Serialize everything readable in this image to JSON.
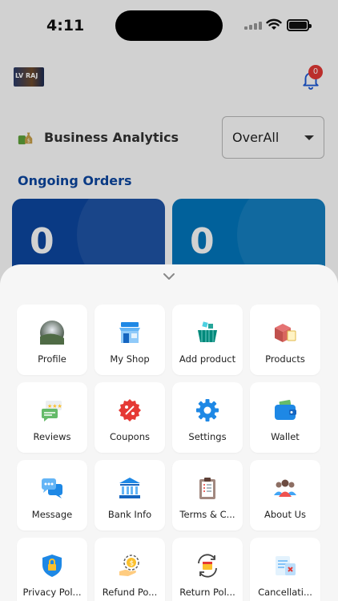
{
  "status_bar": {
    "time": "4:11"
  },
  "header": {
    "logo_text": "LV RAJ",
    "notification_count": "0"
  },
  "analytics": {
    "label": "Business Analytics",
    "filter_value": "OverAll"
  },
  "orders": {
    "title": "Ongoing Orders",
    "cards": [
      "0",
      "0"
    ]
  },
  "menu": {
    "items": [
      {
        "label": "Profile",
        "icon": "profile-avatar-icon"
      },
      {
        "label": "My Shop",
        "icon": "shop-icon"
      },
      {
        "label": "Add product",
        "icon": "add-product-icon"
      },
      {
        "label": "Products",
        "icon": "products-box-icon"
      },
      {
        "label": "Reviews",
        "icon": "reviews-icon"
      },
      {
        "label": "Coupons",
        "icon": "coupon-icon"
      },
      {
        "label": "Settings",
        "icon": "gear-icon"
      },
      {
        "label": "Wallet",
        "icon": "wallet-icon"
      },
      {
        "label": "Message",
        "icon": "chat-icon"
      },
      {
        "label": "Bank Info",
        "icon": "bank-icon"
      },
      {
        "label": "Terms & C...",
        "icon": "clipboard-icon"
      },
      {
        "label": "About Us",
        "icon": "people-icon"
      },
      {
        "label": "Privacy Pol...",
        "icon": "shield-lock-icon"
      },
      {
        "label": "Refund Po...",
        "icon": "refund-icon"
      },
      {
        "label": "Return Pol...",
        "icon": "return-box-icon"
      },
      {
        "label": "Cancellati...",
        "icon": "cancel-doc-icon"
      }
    ]
  }
}
